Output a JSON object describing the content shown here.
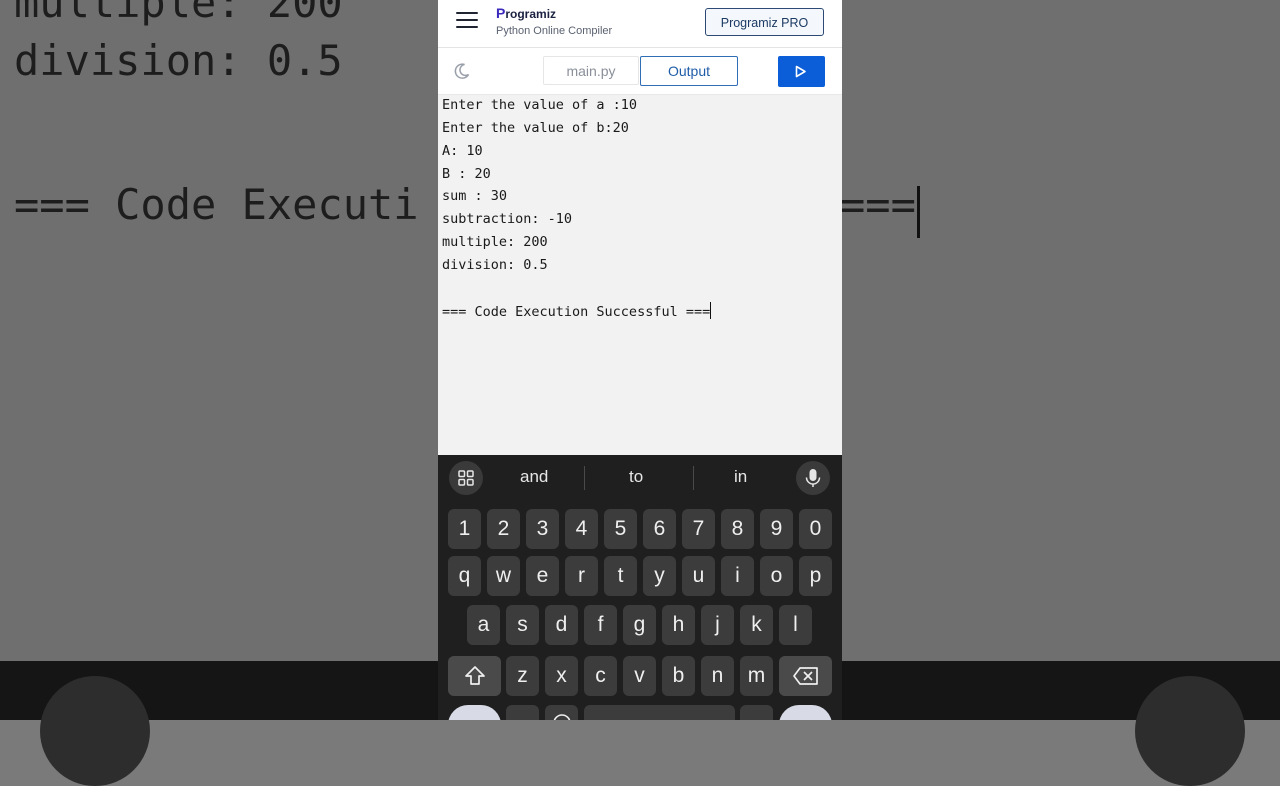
{
  "background": {
    "left_lines": [
      "multiple: 200",
      "division: 0.5",
      "=== Code Executi"
    ],
    "right_lines": [
      "==="
    ]
  },
  "header": {
    "logo_text": "rogramiz",
    "logo_letter": "P",
    "subtitle": "Python Online Compiler",
    "pro_button": "Programiz PRO"
  },
  "toolbar": {
    "file_tab": "main.py",
    "output_tab": "Output"
  },
  "output": {
    "lines": [
      "Enter the value of a :10",
      "Enter the value of b:20",
      "A: 10",
      "B : 20",
      "sum : 30",
      "subtraction: -10",
      "multiple: 200",
      "division: 0.5",
      "",
      "=== Code Execution Successful ==="
    ]
  },
  "keyboard": {
    "suggestions": [
      "and",
      "to",
      "in"
    ],
    "rows": {
      "numbers": [
        "1",
        "2",
        "3",
        "4",
        "5",
        "6",
        "7",
        "8",
        "9",
        "0"
      ],
      "row1": [
        "q",
        "w",
        "e",
        "r",
        "t",
        "y",
        "u",
        "i",
        "o",
        "p"
      ],
      "row2": [
        "a",
        "s",
        "d",
        "f",
        "g",
        "h",
        "j",
        "k",
        "l"
      ],
      "row3": [
        "z",
        "x",
        "c",
        "v",
        "b",
        "n",
        "m"
      ]
    }
  },
  "colors": {
    "accent": "#0b5ed7",
    "output_bg": "#f2f2f2",
    "keyboard_bg": "#1f1f1f"
  }
}
